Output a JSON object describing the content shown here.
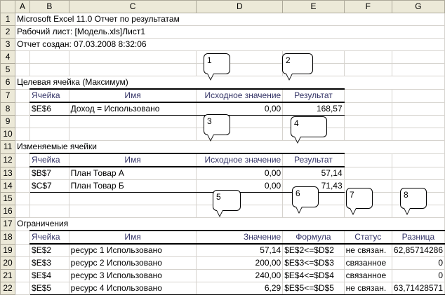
{
  "columns": [
    "A",
    "B",
    "C",
    "D",
    "E",
    "F",
    "G"
  ],
  "rows": [
    "1",
    "2",
    "3",
    "4",
    "5",
    "6",
    "7",
    "8",
    "9",
    "10",
    "11",
    "12",
    "13",
    "14",
    "15",
    "16",
    "17",
    "18",
    "19",
    "20",
    "21",
    "22"
  ],
  "title_lines": [
    "Microsoft Excel 11.0 Отчет по результатам",
    "Рабочий лист: [Модель.xls]Лист1",
    "Отчет создан: 07.03.2008 8:32:06"
  ],
  "target": {
    "section_label": "Целевая ячейка (Максимум)",
    "headers": [
      "Ячейка",
      "Имя",
      "Исходное значение",
      "Результат"
    ],
    "rows": [
      [
        "$E$6",
        "Доход = Использовано",
        "0,00",
        "168,57"
      ]
    ]
  },
  "variables": {
    "section_label": "Изменяемые ячейки",
    "headers": [
      "Ячейка",
      "Имя",
      "Исходное значение",
      "Результат"
    ],
    "rows": [
      [
        "$B$7",
        "План Товар А",
        "0,00",
        "57,14"
      ],
      [
        "$C$7",
        "План Товар Б",
        "0,00",
        "71,43"
      ]
    ]
  },
  "constraints": {
    "section_label": "Ограничения",
    "headers": [
      "Ячейка",
      "Имя",
      "Значение",
      "Формула",
      "Статус",
      "Разница"
    ],
    "rows": [
      [
        "$E$2",
        "ресурс 1 Использовано",
        "57,14",
        "$E$2<=$D$2",
        "не связан.",
        "62,85714286"
      ],
      [
        "$E$3",
        "ресурс 2 Использовано",
        "200,00",
        "$E$3<=$D$3",
        "связанное",
        "0"
      ],
      [
        "$E$4",
        "ресурс 3  Использовано",
        "240,00",
        "$E$4<=$D$4",
        "связанное",
        "0"
      ],
      [
        "$E$5",
        "ресурс 4  Использовано",
        "6,29",
        "$E$5<=$D$5",
        "не связан.",
        "63,71428571"
      ]
    ]
  },
  "callouts": [
    "1",
    "2",
    "3",
    "4",
    "5",
    "6",
    "7",
    "8"
  ]
}
